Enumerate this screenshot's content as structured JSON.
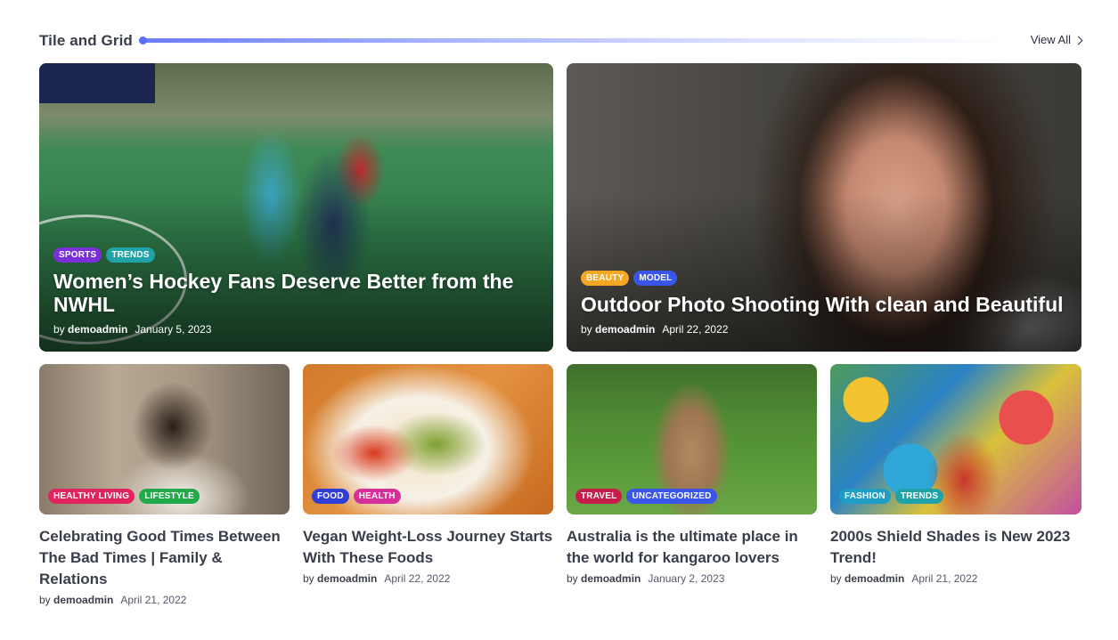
{
  "section": {
    "title": "Tile and Grid",
    "view_all": "View All"
  },
  "featured": [
    {
      "tags": [
        {
          "label": "SPORTS",
          "color": "#7b2fd9"
        },
        {
          "label": "TRENDS",
          "color": "#1fa3a8"
        }
      ],
      "title": "Women’s Hockey Fans Deserve Better from the NWHL",
      "by": "by",
      "author": "demoadmin",
      "date": "January 5, 2023"
    },
    {
      "tags": [
        {
          "label": "BEAUTY",
          "color": "#f5a623"
        },
        {
          "label": "MODEL",
          "color": "#3a56e8"
        }
      ],
      "title": "Outdoor Photo Shooting With clean and Beautiful",
      "by": "by",
      "author": "demoadmin",
      "date": "April 22, 2022"
    }
  ],
  "posts": [
    {
      "tags": [
        {
          "label": "HEALTHY LIVING",
          "color": "#e0245e"
        },
        {
          "label": "LIFESTYLE",
          "color": "#22a94a"
        }
      ],
      "title": "Celebrating Good Times Between The Bad Times | Family & Relations",
      "by": "by",
      "author": "demoadmin",
      "date": "April 21, 2022"
    },
    {
      "tags": [
        {
          "label": "FOOD",
          "color": "#2f3fd6"
        },
        {
          "label": "HEALTH",
          "color": "#d62f9a"
        }
      ],
      "title": "Vegan Weight-Loss Journey Starts With These Foods",
      "by": "by",
      "author": "demoadmin",
      "date": "April 22, 2022"
    },
    {
      "tags": [
        {
          "label": "TRAVEL",
          "color": "#c41d4a"
        },
        {
          "label": "UNCATEGORIZED",
          "color": "#3a56e8"
        }
      ],
      "title": "Australia is the ultimate place in the world for kangaroo lovers",
      "by": "by",
      "author": "demoadmin",
      "date": "January 2, 2023"
    },
    {
      "tags": [
        {
          "label": "FASHION",
          "color": "#1e9ec4"
        },
        {
          "label": "TRENDS",
          "color": "#1fa3a8"
        }
      ],
      "title": "2000s Shield Shades is New 2023 Trend!",
      "by": "by",
      "author": "demoadmin",
      "date": "April 21, 2022"
    }
  ],
  "icons": {
    "view_all": "chevron-right-icon"
  }
}
